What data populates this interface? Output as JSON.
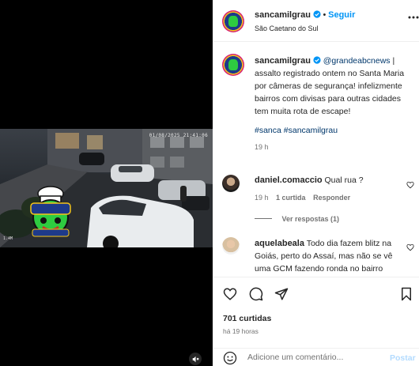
{
  "video": {
    "timestamp": "01/08/2025 21:41:06",
    "corner_label": "1.4M"
  },
  "header": {
    "username": "sancamilgrau",
    "follow_label": "Seguir",
    "separator": "•",
    "location": "São Caetano do Sul"
  },
  "caption": {
    "username": "sancamilgrau",
    "mention": "@grandeabcnews",
    "text": " | assalto registrado ontem no Santa Maria por câmeras de segurança! infelizmente bairros com divisas para outras cidades tem muita rota de escape!",
    "tag1": "#sanca",
    "tag2": "#sancamilgrau",
    "time": "19 h"
  },
  "comments": [
    {
      "username": "daniel.comaccio",
      "text": "Qual rua ?",
      "time": "19 h",
      "likes": "1 curtida",
      "reply": "Responder",
      "view_replies": "Ver respostas (1)"
    },
    {
      "username": "aquelabeala",
      "text": "Todo dia fazem blitz na Goiás, perto do Assaí, mas não se vê uma GCM fazendo ronda no bairro"
    }
  ],
  "actions": {
    "likes_count": "701 curtidas",
    "time_ago": "há 19 horas"
  },
  "add_comment": {
    "placeholder": "Adicione um comentário...",
    "post_label": "Postar"
  },
  "colors": {
    "link_blue": "#0095f6",
    "mention_blue": "#00376b",
    "verified_blue": "#0095f6",
    "muted_text": "#737373"
  }
}
